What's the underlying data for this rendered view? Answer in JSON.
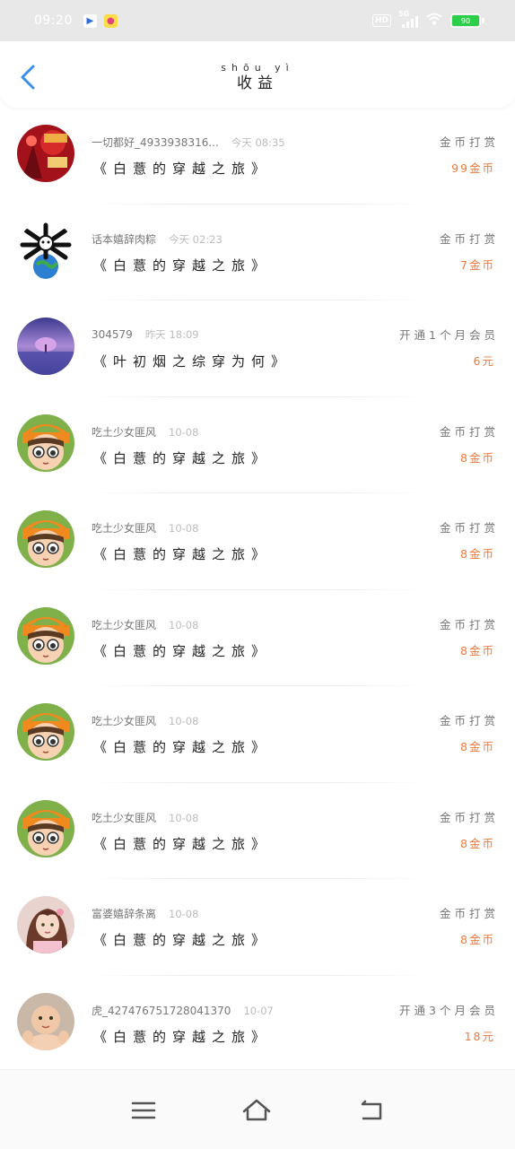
{
  "status_bar": {
    "time": "09:20",
    "hd": "HD",
    "signal": "5G",
    "battery": "90",
    "battery_color": "#2dcf4a"
  },
  "header": {
    "title_pinyin": "shōu yì",
    "title": "收益",
    "back_icon": "chevron-left-icon",
    "accent": "#3a8ee6"
  },
  "records": [
    {
      "name": "一切都好_4933938316...",
      "time": "今天 08:35",
      "book": "《白薏的穿越之旅》",
      "gift": "金币打赏",
      "amount": "99金币",
      "avatar": "red-new-year"
    },
    {
      "name": "话本嬉辞肉粽",
      "time": "今天 02:23",
      "book": "《白薏的穿越之旅》",
      "gift": "金币打赏",
      "amount": "7金币",
      "avatar": "bones-globe"
    },
    {
      "name": "304579",
      "time": "昨天 18:09",
      "book": "《叶初烟之综穿为何》",
      "gift": "开通1个月会员",
      "amount": "6元",
      "avatar": "purple-landscape"
    },
    {
      "name": "吃土少女匪风",
      "time": "10-08",
      "book": "《白薏的穿越之旅》",
      "gift": "金币打赏",
      "amount": "8金币",
      "avatar": "cartoon-girl"
    },
    {
      "name": "吃土少女匪风",
      "time": "10-08",
      "book": "《白薏的穿越之旅》",
      "gift": "金币打赏",
      "amount": "8金币",
      "avatar": "cartoon-girl"
    },
    {
      "name": "吃土少女匪风",
      "time": "10-08",
      "book": "《白薏的穿越之旅》",
      "gift": "金币打赏",
      "amount": "8金币",
      "avatar": "cartoon-girl"
    },
    {
      "name": "吃土少女匪风",
      "time": "10-08",
      "book": "《白薏的穿越之旅》",
      "gift": "金币打赏",
      "amount": "8金币",
      "avatar": "cartoon-girl"
    },
    {
      "name": "吃土少女匪风",
      "time": "10-08",
      "book": "《白薏的穿越之旅》",
      "gift": "金币打赏",
      "amount": "8金币",
      "avatar": "cartoon-girl"
    },
    {
      "name": "富婆嬉辞条离",
      "time": "10-08",
      "book": "《白薏的穿越之旅》",
      "gift": "金币打赏",
      "amount": "8金币",
      "avatar": "pink-girl"
    },
    {
      "name": "虎_427476751728041370",
      "time": "10-07",
      "book": "《白薏的穿越之旅》",
      "gift": "开通3个月会员",
      "amount": "18元",
      "avatar": "baby"
    }
  ],
  "navbar": {
    "menu_icon": "menu-icon",
    "home_icon": "home-icon",
    "back_icon": "back-icon"
  },
  "colors": {
    "amount": "#ee7a3c",
    "muted": "#bdbdbd"
  }
}
